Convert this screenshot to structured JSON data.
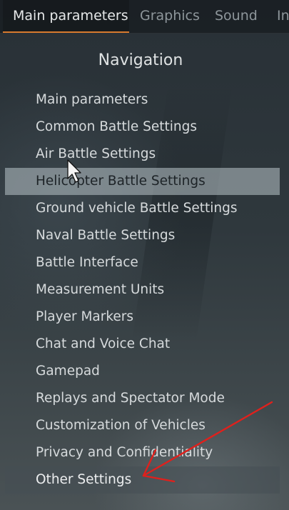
{
  "tabs": [
    {
      "label": "Main parameters",
      "active": true
    },
    {
      "label": "Graphics",
      "active": false
    },
    {
      "label": "Sound",
      "active": false
    },
    {
      "label": "In",
      "active": false
    }
  ],
  "navigation": {
    "title": "Navigation",
    "items": [
      {
        "label": "Main parameters"
      },
      {
        "label": "Common Battle Settings"
      },
      {
        "label": "Air Battle Settings"
      },
      {
        "label": "Helicopter Battle Settings",
        "state": "hovered"
      },
      {
        "label": "Ground vehicle Battle Settings"
      },
      {
        "label": "Naval Battle Settings"
      },
      {
        "label": "Battle Interface"
      },
      {
        "label": "Measurement Units"
      },
      {
        "label": "Player Markers"
      },
      {
        "label": "Chat and Voice Chat"
      },
      {
        "label": "Gamepad"
      },
      {
        "label": "Replays and Spectator Mode"
      },
      {
        "label": "Customization of Vehicles"
      },
      {
        "label": "Privacy and Confidentiality"
      },
      {
        "label": "Other Settings",
        "state": "selected"
      }
    ]
  },
  "colors": {
    "accent": "#d77a2e",
    "annotation_arrow": "#e0201c",
    "hover_row": "#aab4ba",
    "selected_row": "#464e54"
  },
  "icons": {
    "cursor": "mouse-pointer-icon",
    "annotation": "red-arrow-annotation"
  }
}
